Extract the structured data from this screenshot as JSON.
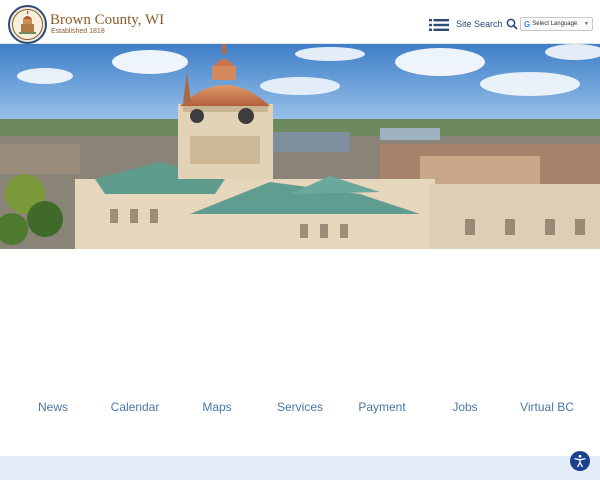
{
  "header": {
    "title": "Brown County, WI",
    "subtitle": "Established 1818",
    "menu_icon": "hamburger-list-icon",
    "search_label": "Site Search",
    "search_icon": "magnifier-icon",
    "language_label": "Select Language",
    "language_arrow": "▼",
    "google_letter": "G"
  },
  "hero": {
    "image": "courthouse-aerial-photo"
  },
  "quicklinks": [
    {
      "label": "News"
    },
    {
      "label": "Calendar"
    },
    {
      "label": "Maps"
    },
    {
      "label": "Services"
    },
    {
      "label": "Payment"
    },
    {
      "label": "Jobs"
    },
    {
      "label": "Virtual BC"
    }
  ],
  "accessibility": {
    "icon": "accessibility-icon"
  },
  "colors": {
    "brand": "#8a5a2a",
    "navy": "#2d4a7a",
    "link": "#4a78a8",
    "strip": "#e3edf7"
  }
}
